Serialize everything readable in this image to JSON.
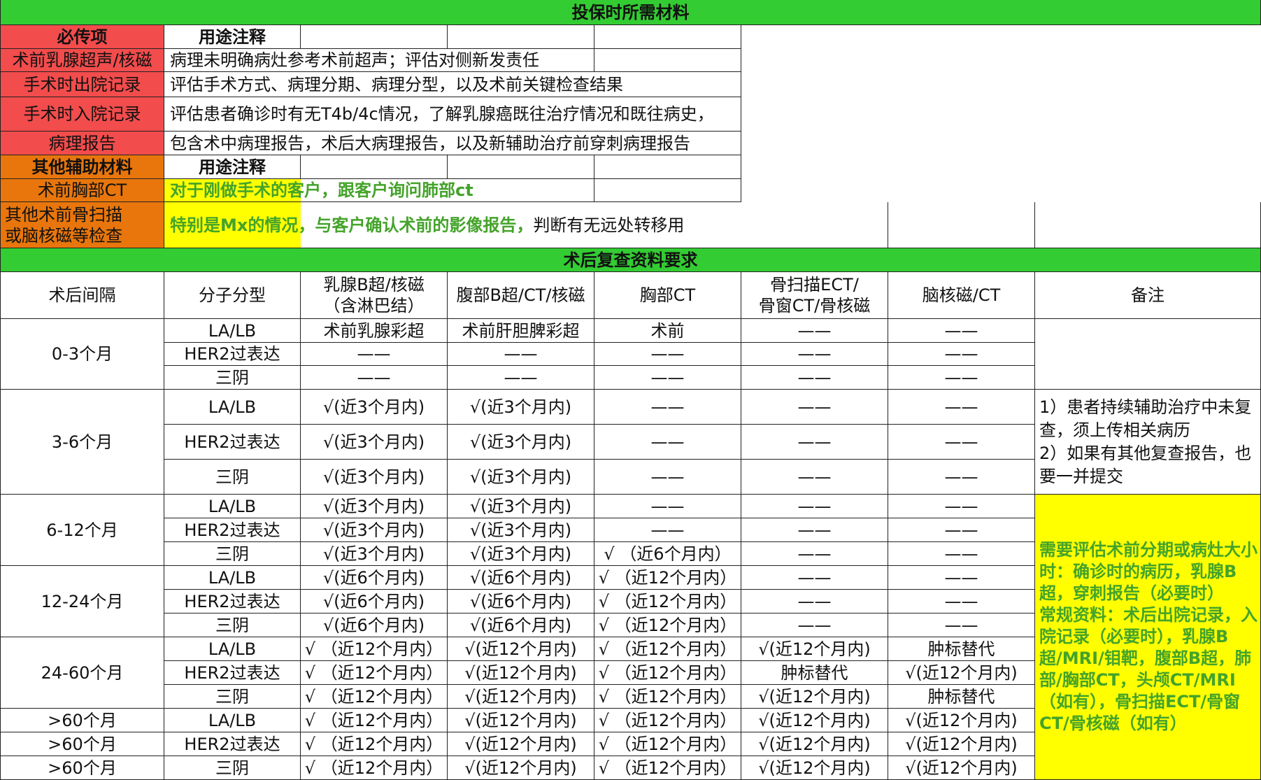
{
  "top_banner": "投保时所需材料",
  "required": {
    "header": "必传项",
    "col_label": "用途注释",
    "items": [
      {
        "name": "术前乳腺超声/核磁",
        "note": "病理未明确病灶参考术前超声；评估对侧新发责任"
      },
      {
        "name": "手术时出院记录",
        "note": "评估手术方式、病理分期、病理分型，以及术前关键检查结果"
      },
      {
        "name": "手术时入院记录",
        "note": "评估患者确诊时有无T4b/4c情况，了解乳腺癌既往治疗情况和既往病史，"
      },
      {
        "name": "病理报告",
        "note": "包含术中病理报告，术后大病理报告，以及新辅助治疗前穿刺病理报告"
      }
    ]
  },
  "auxiliary": {
    "header": "其他辅助材料",
    "col_label": "用途注释",
    "items": [
      {
        "name": "术前胸部CT",
        "note": "对于刚做手术的客户，跟客户询问肺部ct"
      },
      {
        "name": "其他术前骨扫描\n或脑核磁等检查",
        "note_highlight": "特别是Mx的情况，与客户确认术前的影像报告，",
        "note_rest": "判断有无远处转移用"
      }
    ]
  },
  "followup": {
    "banner": "术后复查资料要求",
    "headers": [
      "术后间隔",
      "分子分型",
      "乳腺B超/核磁\n（含淋巴结）",
      "腹部B超/CT/核磁",
      "胸部CT",
      "骨扫描ECT/\n骨窗CT/骨核磁",
      "脑核磁/CT",
      "备注"
    ],
    "groups": [
      {
        "interval": "0-3个月",
        "rows": [
          [
            "LA/LB",
            "术前乳腺彩超",
            "术前肝胆脾彩超",
            "术前",
            "——",
            "——"
          ],
          [
            "HER2过表达",
            "——",
            "——",
            "——",
            "——",
            "——"
          ],
          [
            "三阴",
            "——",
            "——",
            "——",
            "——",
            "——"
          ]
        ]
      },
      {
        "interval": "3-6个月",
        "rows": [
          [
            "LA/LB",
            "√(近3个月内)",
            "√(近3个月内)",
            "——",
            "——",
            "——"
          ],
          [
            "HER2过表达",
            "√(近3个月内)",
            "√(近3个月内)",
            "——",
            "——",
            "——"
          ],
          [
            "三阴",
            "√(近3个月内)",
            "√(近3个月内)",
            "——",
            "——",
            "——"
          ]
        ]
      },
      {
        "interval": "6-12个月",
        "rows": [
          [
            "LA/LB",
            "√(近3个月内)",
            "√(近3个月内)",
            "——",
            "——",
            "——"
          ],
          [
            "HER2过表达",
            "√(近3个月内)",
            "√(近3个月内)",
            "——",
            "——",
            "——"
          ],
          [
            "三阴",
            "√(近3个月内)",
            "√(近3个月内)",
            "√ （近6个月内）",
            "——",
            "——"
          ]
        ]
      },
      {
        "interval": "12-24个月",
        "rows": [
          [
            "LA/LB",
            "√(近6个月内)",
            "√(近6个月内)",
            "√ （近12个月内）",
            "——",
            "——"
          ],
          [
            "HER2过表达",
            "√(近6个月内)",
            "√(近6个月内)",
            "√ （近12个月内）",
            "——",
            "——"
          ],
          [
            "三阴",
            "√(近6个月内)",
            "√(近6个月内)",
            "√ （近12个月内）",
            "——",
            "——"
          ]
        ]
      },
      {
        "interval": "24-60个月",
        "rows": [
          [
            "LA/LB",
            "√ （近12个月内）",
            "√(近12个月内)",
            "√ （近12个月内）",
            "√(近12个月内)",
            "肿标替代"
          ],
          [
            "HER2过表达",
            "√ （近12个月内）",
            "√(近12个月内)",
            "√ （近12个月内）",
            "肿标替代",
            "√(近12个月内)"
          ],
          [
            "三阴",
            "√ （近12个月内）",
            "√(近12个月内)",
            "√ （近12个月内）",
            "√(近12个月内)",
            "肿标替代"
          ]
        ]
      },
      {
        "interval": ">60个月",
        "rows": [
          [
            "LA/LB",
            "√ （近12个月内）",
            "√(近12个月内)",
            "√ （近12个月内）",
            "√(近12个月内)",
            "√(近12个月内)"
          ]
        ]
      },
      {
        "interval": ">60个月",
        "rows": [
          [
            "HER2过表达",
            "√ （近12个月内）",
            "√(近12个月内)",
            "√ （近12个月内）",
            "√(近12个月内)",
            "√(近12个月内)"
          ]
        ]
      },
      {
        "interval": ">60个月",
        "rows": [
          [
            "三阴",
            "√ （近12个月内）",
            "√(近12个月内)",
            "√ （近12个月内）",
            "√(近12个月内)",
            "√(近12个月内)"
          ]
        ]
      }
    ],
    "note_white": "1）患者持续辅助治疗中未复查，须上传相关病历\n2）如果有其他复查报告，也要一并提交",
    "note_yellow": "需要评估术前分期或病灶大小时：确诊时的病历，乳腺B超，穿刺报告（必要时）\n常规资料：术后出院记录，入院记录（必要时），乳腺B超/MRI/钼靶，腹部B超，肺部/胸部CT，头颅CT/MRI（如有），骨扫描ECT/骨窗CT/骨核磁（如有）"
  }
}
